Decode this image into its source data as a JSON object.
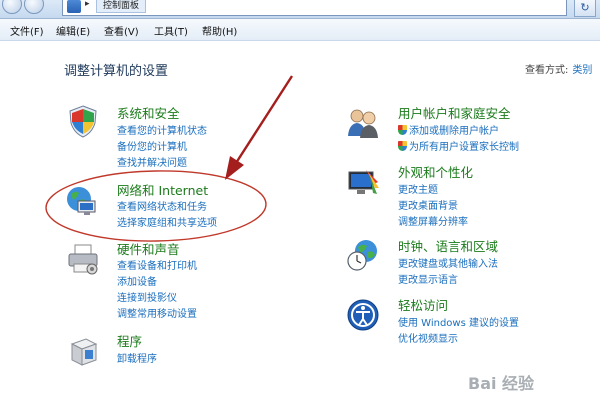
{
  "address": {
    "crumb": "控制面板"
  },
  "menu": [
    {
      "label": "文件(F)"
    },
    {
      "label": "编辑(E)"
    },
    {
      "label": "查看(V)"
    },
    {
      "label": "工具(T)"
    },
    {
      "label": "帮助(H)"
    }
  ],
  "page_title": "调整计算机的设置",
  "view_by": {
    "label": "查看方式:",
    "value": "类别"
  },
  "categories": {
    "security": {
      "icon": "security-shield-icon",
      "title": "系统和安全",
      "links": [
        "查看您的计算机状态",
        "备份您的计算机",
        "查找并解决问题"
      ]
    },
    "network": {
      "icon": "network-globe-icon",
      "title": "网络和 Internet",
      "links": [
        "查看网络状态和任务",
        "选择家庭组和共享选项"
      ]
    },
    "hardware": {
      "icon": "printer-icon",
      "title": "硬件和声音",
      "links": [
        "查看设备和打印机",
        "添加设备",
        "连接到投影仪",
        "调整常用移动设置"
      ]
    },
    "programs": {
      "icon": "program-box-icon",
      "title": "程序",
      "links": [
        "卸载程序"
      ]
    },
    "users": {
      "icon": "users-icon",
      "title": "用户帐户和家庭安全",
      "links": [
        "添加或删除用户帐户",
        "为所有用户设置家长控制"
      ]
    },
    "appearance": {
      "icon": "appearance-monitor-icon",
      "title": "外观和个性化",
      "links": [
        "更改主题",
        "更改桌面背景",
        "调整屏幕分辨率"
      ]
    },
    "clock": {
      "icon": "clock-globe-icon",
      "title": "时钟、语言和区域",
      "links": [
        "更改键盘或其他输入法",
        "更改显示语言"
      ]
    },
    "ease": {
      "icon": "ease-of-access-icon",
      "title": "轻松访问",
      "links": [
        "使用 Windows 建议的设置",
        "优化视频显示"
      ]
    }
  },
  "colors": {
    "category_title": "#1b7b1b",
    "link": "#1a6ebd",
    "annotation": "#c0392b"
  },
  "watermark": "Bai 经验"
}
